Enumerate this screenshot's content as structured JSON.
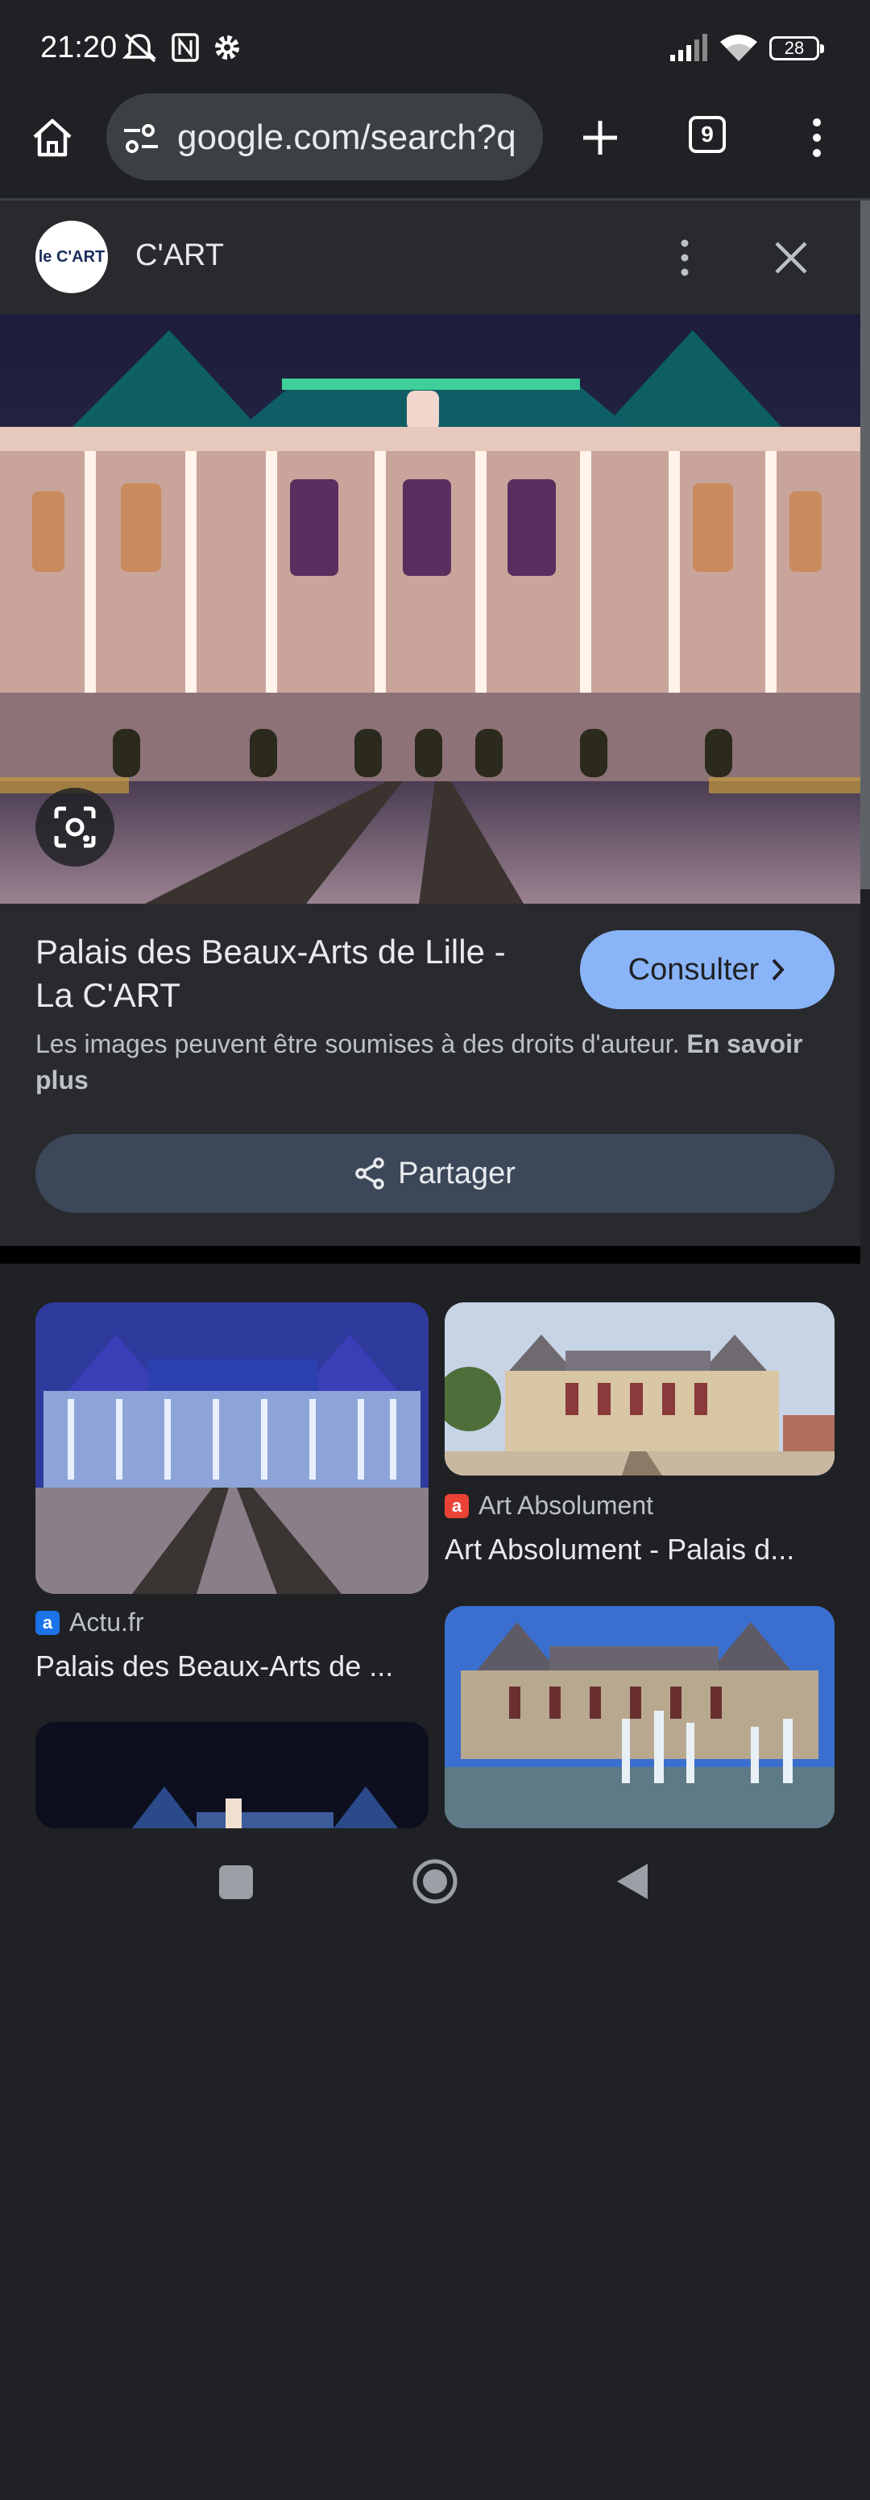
{
  "status_bar": {
    "time": "21:20",
    "battery": "28"
  },
  "browser": {
    "url": "google.com/search?q",
    "tab_count": "9"
  },
  "panel": {
    "source_logo_text": "le C'ART",
    "source_name": "C'ART",
    "title": "Palais des Beaux-Arts de Lille - La C'ART",
    "visit_label": "Consulter",
    "copyright_text": "Les images peuvent être soumises à des droits d'auteur.",
    "learn_more": "En savoir plus",
    "share_label": "Partager"
  },
  "related": [
    {
      "source": "Actu.fr",
      "title": "Palais des Beaux-Arts de ...",
      "favicon_color": "#1a73e8",
      "favicon_letter": "a"
    },
    {
      "source": "Art Absolument",
      "title": "Art Absolument - Palais d...",
      "favicon_color": "#ea4335",
      "favicon_letter": "a"
    }
  ],
  "icons": [
    "home-icon",
    "site-settings-icon",
    "new-tab-icon",
    "tabs-icon",
    "menu-icon",
    "more-vert-icon",
    "close-icon",
    "lens-icon",
    "chevron-right-icon",
    "share-icon",
    "recents-icon",
    "home-nav-icon",
    "back-icon"
  ]
}
